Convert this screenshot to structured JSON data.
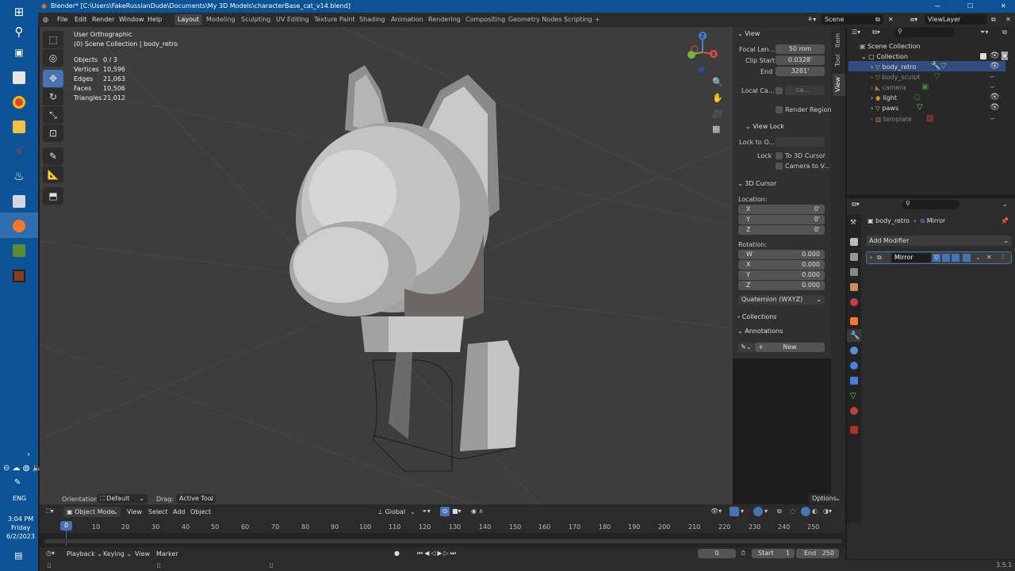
{
  "window": {
    "title": "Blender* [C:\\Users\\FakeRussianDude\\Documents\\My 3D Models\\characterBase_cat_v14.blend]"
  },
  "menu": [
    "File",
    "Edit",
    "Render",
    "Window",
    "Help"
  ],
  "workspaces": [
    "Layout",
    "Modeling",
    "Sculpting",
    "UV Editing",
    "Texture Paint",
    "Shading",
    "Animation",
    "Rendering",
    "Compositing",
    "Geometry Nodes",
    "Scripting"
  ],
  "scene": {
    "scene_name": "Scene",
    "view_layer": "ViewLayer"
  },
  "viewport": {
    "view_name": "User Orthographic",
    "collection_info": "(0) Scene Collection | body_retro",
    "stats": [
      {
        "label": "Objects",
        "value": "0 / 3"
      },
      {
        "label": "Vertices",
        "value": "10,596"
      },
      {
        "label": "Edges",
        "value": "21,063"
      },
      {
        "label": "Faces",
        "value": "10,506"
      },
      {
        "label": "Triangles",
        "value": "21,012"
      }
    ],
    "orientation_label": "Orientation:",
    "orientation_value": "Default",
    "drag_label": "Drag:",
    "drag_value": "Active Tool",
    "options": "Options"
  },
  "npanel": {
    "view_header": "View",
    "focal_label": "Focal Len...",
    "focal_value": "50 mm",
    "clip_start_label": "Clip Start",
    "clip_start_value": "0.0328'",
    "end_label": "End",
    "end_value": "3281'",
    "local_camera_label": "Local Ca...",
    "local_camera_value": "ca...",
    "render_region": "Render Region",
    "view_lock_header": "View Lock",
    "lock_to_label": "Lock to O...",
    "lock_label": "Lock",
    "to_3d_cursor": "To 3D Cursor",
    "camera_to_view": "Camera to V...",
    "cursor_header": "3D Cursor",
    "location_label": "Location:",
    "loc": [
      {
        "axis": "X",
        "value": "0'"
      },
      {
        "axis": "Y",
        "value": "0'"
      },
      {
        "axis": "Z",
        "value": "0'"
      }
    ],
    "rotation_label": "Rotation:",
    "rot": [
      {
        "axis": "W",
        "value": "0.000"
      },
      {
        "axis": "X",
        "value": "0.000"
      },
      {
        "axis": "Y",
        "value": "0.000"
      },
      {
        "axis": "Z",
        "value": "0.000"
      }
    ],
    "rotation_mode": "Quaternion (WXYZ)",
    "collections_header": "Collections",
    "annotations_header": "Annotations",
    "new_button": "New"
  },
  "side_tabs": [
    "Item",
    "Tool",
    "View"
  ],
  "outliner": {
    "scene_collection": "Scene Collection",
    "collection": "Collection",
    "items": [
      "body_retro",
      "body_sculpt",
      "camera",
      "light",
      "paws",
      "template"
    ]
  },
  "properties": {
    "object_name": "body_retro",
    "modifier_crumb": "Mirror",
    "add_modifier": "Add Modifier",
    "modifier_name": "Mirror"
  },
  "header": {
    "mode": "Object Mode",
    "menus": [
      "View",
      "Select",
      "Add",
      "Object"
    ],
    "transform": "Global"
  },
  "timeline": {
    "ticks": [
      "0",
      "10",
      "20",
      "30",
      "40",
      "50",
      "60",
      "70",
      "80",
      "90",
      "100",
      "110",
      "120",
      "130",
      "140",
      "150",
      "160",
      "170",
      "180",
      "190",
      "200",
      "210",
      "220",
      "230",
      "240",
      "250"
    ],
    "menus": [
      "Playback",
      "Keying",
      "View",
      "Marker"
    ],
    "current_frame": "0",
    "start_label": "Start",
    "start_value": "1",
    "end_label": "End",
    "end_value": "250"
  },
  "statusbar": {
    "version": "3.5.1"
  },
  "taskbar": {
    "time": "3:04 PM",
    "day": "Friday",
    "date": "6/2/2023",
    "lang": "ENG"
  }
}
